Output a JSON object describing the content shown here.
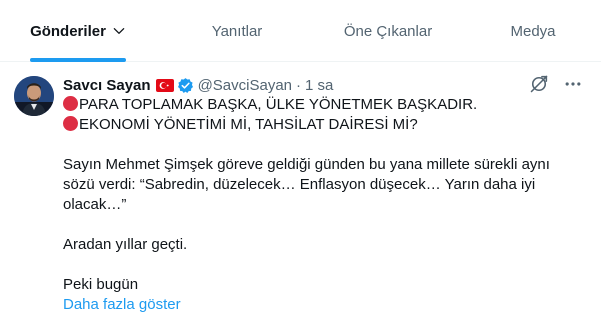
{
  "tabs": [
    {
      "label": "Gönderiler",
      "active": true
    },
    {
      "label": "Yanıtlar",
      "active": false
    },
    {
      "label": "Öne Çıkanlar",
      "active": false
    },
    {
      "label": "Medya",
      "active": false
    }
  ],
  "tweet": {
    "author_name": "Savcı Sayan",
    "handle": "@SavciSayan",
    "separator": "·",
    "time": "1 sa",
    "lines": [
      "PARA TOPLAMAK BAŞKA, ÜLKE YÖNETMEK BAŞKADIR.",
      "EKONOMİ YÖNETİMİ Mİ, TAHSİLAT DAİRESİ Mİ?"
    ],
    "paragraph1": "Sayın Mehmet Şimşek göreve geldiği günden bu yana millete sürekli aynı sözü verdi: “Sabredin, düzelecek… Enflasyon düşecek… Yarın daha iyi olacak…”",
    "paragraph2": "Aradan yıllar geçti.",
    "paragraph3": "Peki bugün",
    "show_more": "Daha fazla göster"
  },
  "icons": {
    "flag": "turkey-flag-icon",
    "verified": "verified-badge-icon",
    "grok": "grok-icon",
    "more": "more-options-icon",
    "red_circle": "red-circle-emoji"
  },
  "colors": {
    "accent": "#1d9bf0",
    "text": "#0f1419",
    "muted": "#536471",
    "red_circle": "#dd2e44"
  }
}
